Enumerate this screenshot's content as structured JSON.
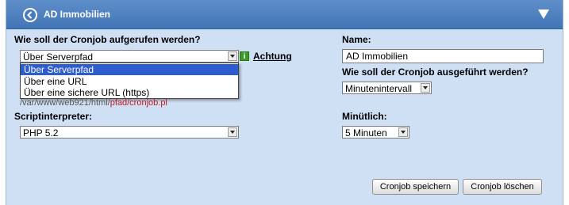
{
  "header": {
    "title": "AD Immobilien"
  },
  "left": {
    "call_question": "Wie soll der Cronjob aufgerufen werden?",
    "call_selected": "Über Serverpfad",
    "call_options": [
      "Über Serverpfad",
      "Über eine URL",
      "Über eine sichere URL (https)"
    ],
    "warning_link": "Achtung",
    "path_prefix": "/var/www/web921/html/",
    "path_highlight": "pfad/cronjob.pl",
    "interpreter_label": "Scriptinterpreter:",
    "interpreter_value": "PHP 5.2"
  },
  "right": {
    "name_label": "Name:",
    "name_value": "AD Immobilien",
    "exec_question": "Wie soll der Cronjob ausgeführt werden?",
    "exec_value": "Minutenintervall",
    "minute_label": "Minütlich:",
    "minute_value": "5 Minuten"
  },
  "buttons": {
    "save": "Cronjob speichern",
    "delete": "Cronjob löschen"
  },
  "icons": {
    "back": "back-arrow-icon",
    "collapse": "triangle-down-icon",
    "info": "info-icon"
  },
  "colors": {
    "header": "#4a7bbf",
    "panel": "#cfe0f5",
    "selection": "#2d5dcf",
    "path_highlight": "#c4161c"
  }
}
